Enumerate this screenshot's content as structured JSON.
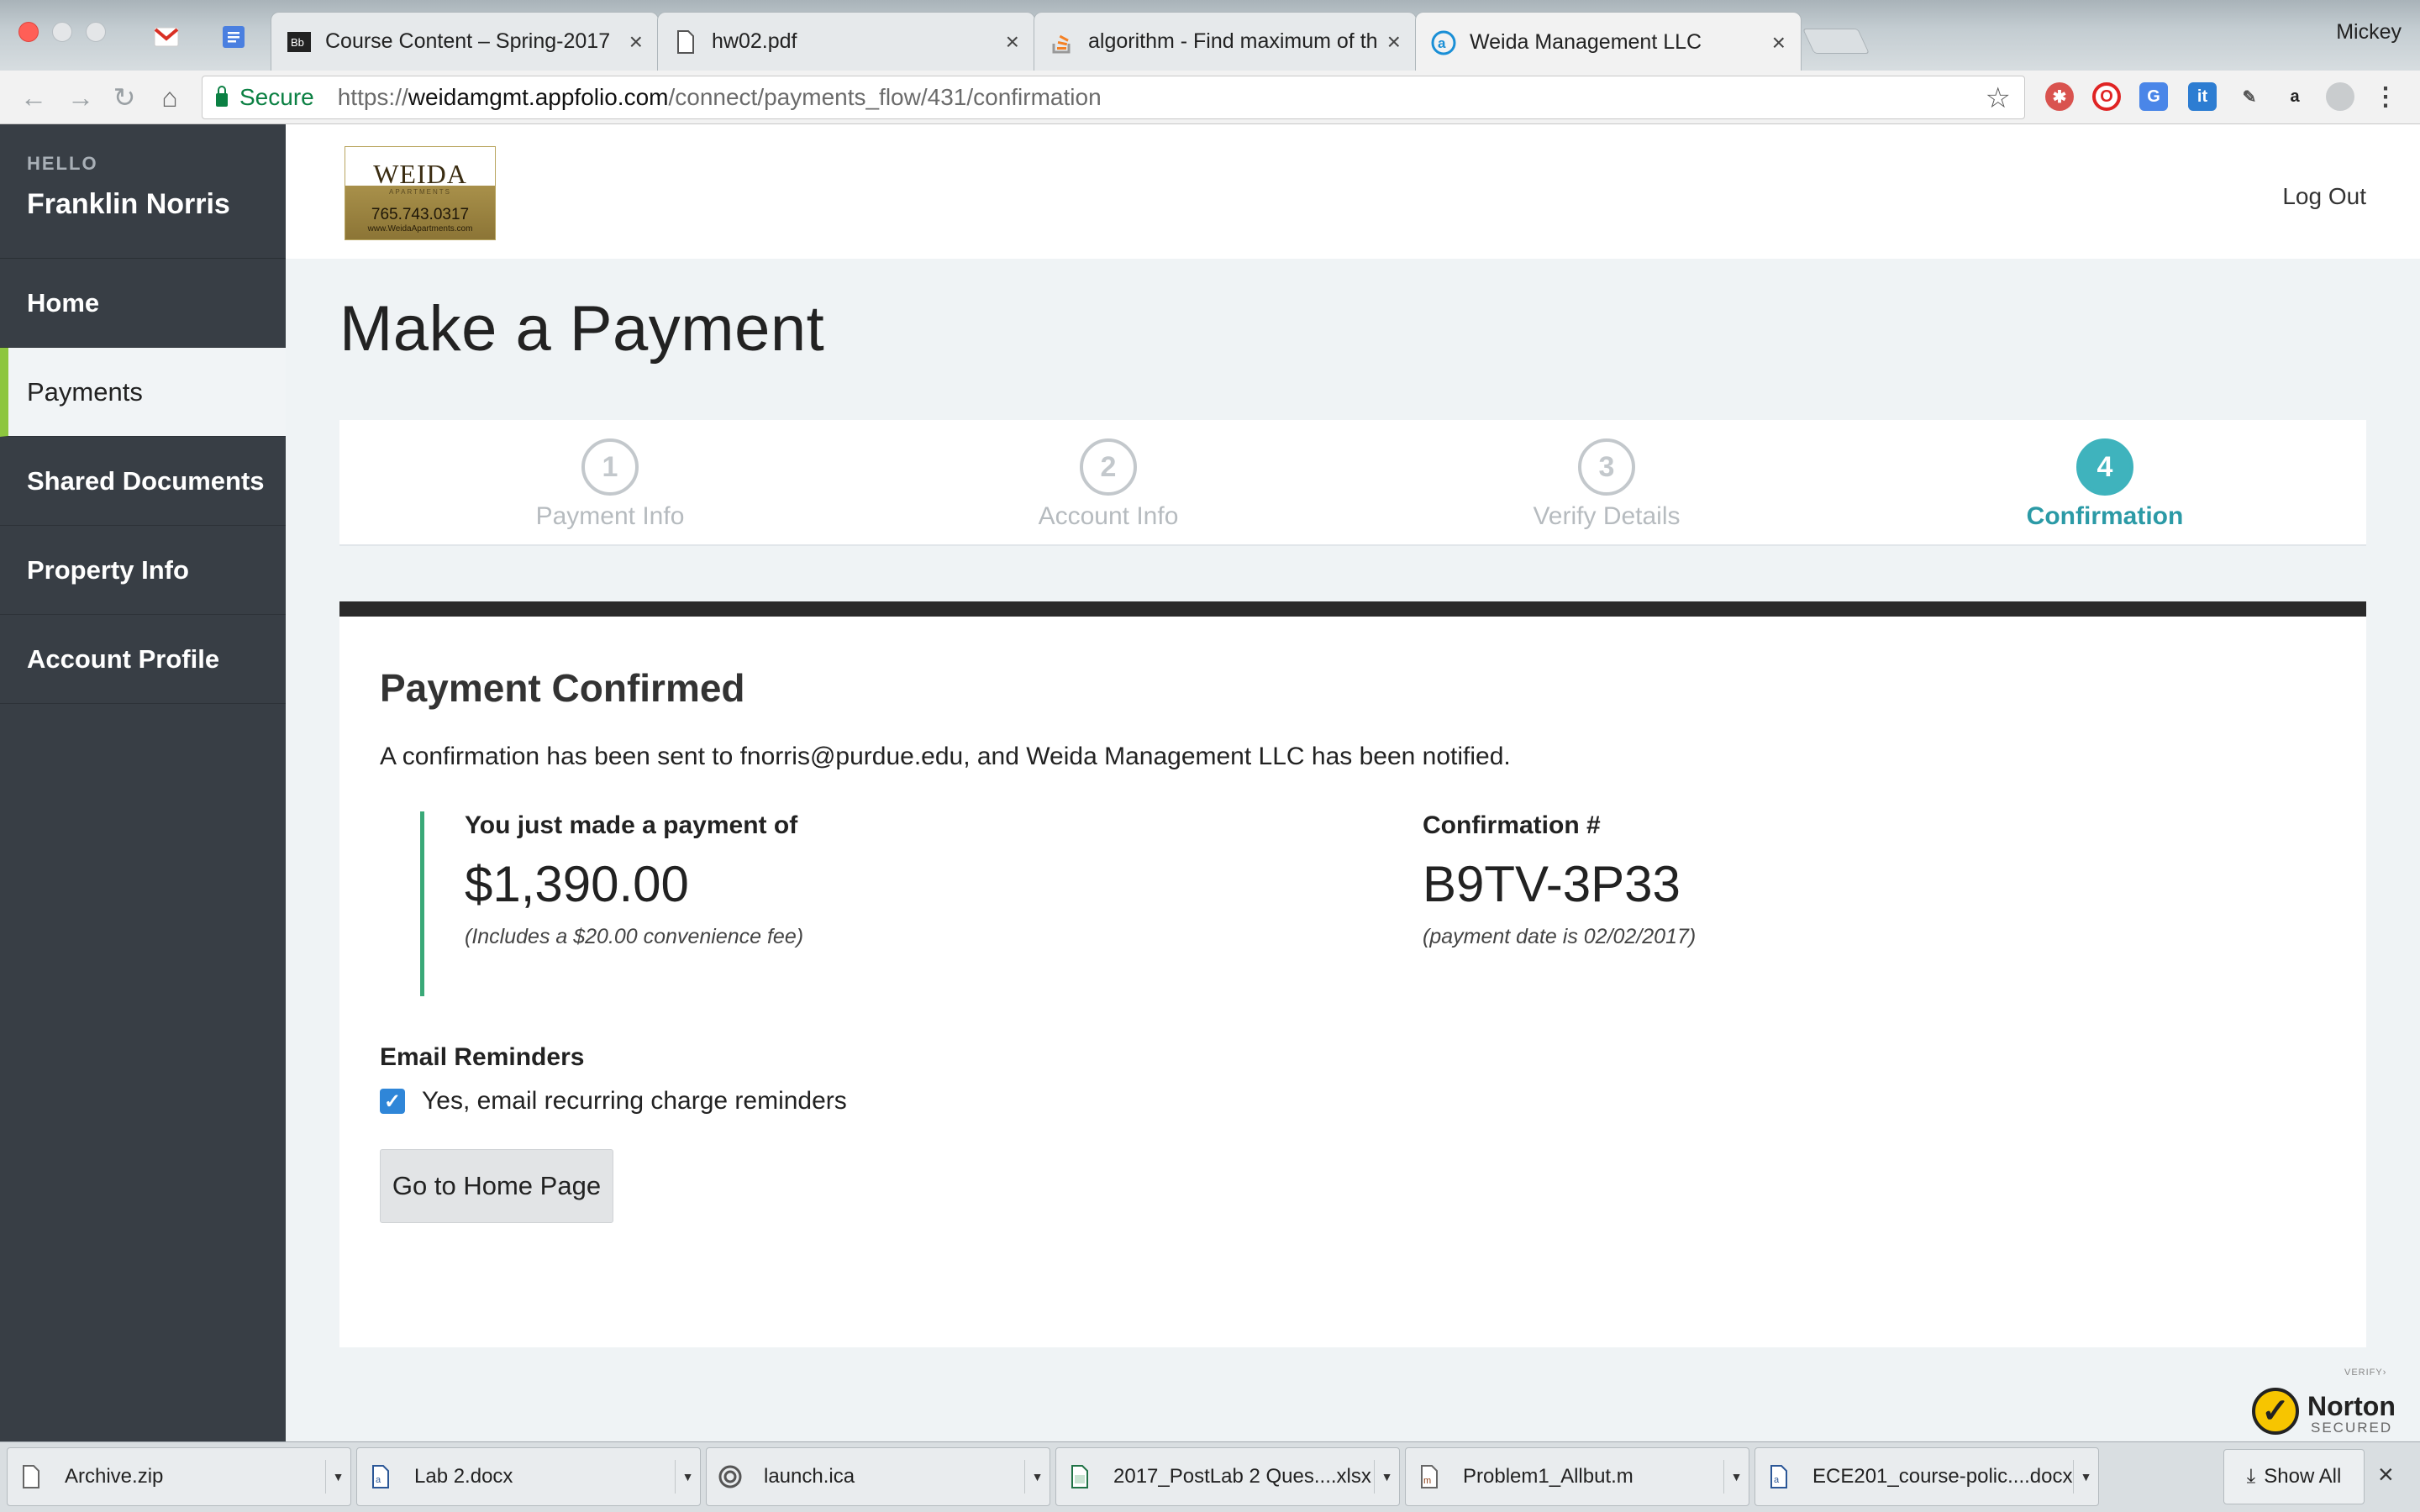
{
  "browser": {
    "tabs": [
      {
        "title": "Course Content – Spring-2017",
        "favicon": "blackboard-icon"
      },
      {
        "title": "hw02.pdf",
        "favicon": "document-icon"
      },
      {
        "title": "algorithm - Find maximum of the",
        "favicon": "stackoverflow-icon"
      },
      {
        "title": "Weida Management LLC",
        "favicon": "appfolio-icon"
      }
    ],
    "profile_name": "Mickey",
    "secure_label": "Secure",
    "url_scheme": "https://",
    "url_host": "weidamgmt.appfolio.com",
    "url_path": "/connect/payments_flow/431/confirmation"
  },
  "sidebar": {
    "hello_label": "HELLO",
    "user_name": "Franklin Norris",
    "items": [
      {
        "label": "Home",
        "active": false
      },
      {
        "label": "Payments",
        "active": true
      },
      {
        "label": "Shared Documents",
        "active": false
      },
      {
        "label": "Property Info",
        "active": false
      },
      {
        "label": "Account Profile",
        "active": false
      }
    ]
  },
  "header": {
    "logo": {
      "name": "WEIDA",
      "sub": "APARTMENTS",
      "phone": "765.743.0317",
      "web": "www.WeidaApartments.com"
    },
    "logout_label": "Log Out"
  },
  "page": {
    "title": "Make a Payment",
    "steps": [
      {
        "number": "1",
        "label": "Payment Info"
      },
      {
        "number": "2",
        "label": "Account Info"
      },
      {
        "number": "3",
        "label": "Verify Details"
      },
      {
        "number": "4",
        "label": "Confirmation"
      }
    ],
    "active_step": 4
  },
  "confirmation": {
    "title": "Payment Confirmed",
    "message": "A confirmation has been sent to fnorris@purdue.edu, and Weida Management LLC has been notified.",
    "amount_label": "You just made a payment of",
    "amount": "$1,390.00",
    "amount_note": "(Includes a $20.00 convenience fee)",
    "confirmation_label": "Confirmation #",
    "confirmation_number": "B9TV-3P33",
    "confirmation_note": "(payment date is 02/02/2017)",
    "email_heading": "Email Reminders",
    "reminder_label": "Yes, email recurring charge reminders",
    "reminder_checked": true,
    "home_button": "Go to Home Page"
  },
  "norton": {
    "verify": "VERIFY›",
    "name": "Norton",
    "secured": "SECURED"
  },
  "downloads": {
    "items": [
      {
        "name": "Archive.zip",
        "icon": "file-icon"
      },
      {
        "name": "Lab 2.docx",
        "icon": "word-doc-icon"
      },
      {
        "name": "launch.ica",
        "icon": "citrix-icon"
      },
      {
        "name": "2017_PostLab 2 Ques....xlsx",
        "icon": "spreadsheet-icon"
      },
      {
        "name": "Problem1_Allbut.m",
        "icon": "matlab-file-icon"
      },
      {
        "name": "ECE201_course-polic....docx",
        "icon": "word-doc-icon"
      }
    ],
    "show_all_label": "Show All"
  },
  "colors": {
    "accent": "#3fb3bd",
    "sidebar": "#383e45",
    "active_marker": "#8dc63f",
    "summary_border": "#3aa978",
    "secure": "#0b8043"
  }
}
